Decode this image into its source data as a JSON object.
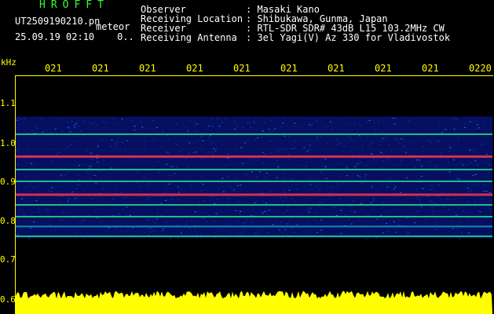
{
  "header": {
    "logo": "HROFFT",
    "filename": "UT2509190210.pn",
    "meteor_label": "meteor",
    "timestamp": "25.09.19 02:10",
    "count": "0.."
  },
  "info": [
    {
      "label": "Observer",
      "value": ": Masaki Kano"
    },
    {
      "label": "Receiving Location",
      "value": ": Shibukawa, Gunma, Japan"
    },
    {
      "label": "Receiver",
      "value": ": RTL-SDR SDR# 43dB L15 103.2MHz CW"
    },
    {
      "label": "Receiving Antenna",
      "value": ": 3el Yagi(V) Az 330 for Vladivostok"
    }
  ],
  "axes": {
    "y_unit": "kHz",
    "y_ticks": [
      "1.1",
      "1.0",
      "0.9",
      "0.8",
      "0.7",
      "0.6"
    ],
    "x_ticks": [
      "021",
      "021",
      "021",
      "021",
      "021",
      "021",
      "021",
      "021",
      "021",
      "0220"
    ]
  },
  "colors": {
    "background": "#000000",
    "axis": "#ffff00",
    "logo": "#33ff33",
    "text": "#ffffff",
    "noise": "#0a1a8c",
    "strong_line": "#ff3355",
    "level_bar": "#ffff00"
  },
  "spectrogram": {
    "y_range": [
      0.6,
      1.15
    ],
    "noise_band": [
      0.755,
      1.065
    ],
    "signal_lines": [
      {
        "freq": 1.02,
        "strength": "medium"
      },
      {
        "freq": 0.963,
        "strength": "strong"
      },
      {
        "freq": 0.93,
        "strength": "medium"
      },
      {
        "freq": 0.9,
        "strength": "medium"
      },
      {
        "freq": 0.866,
        "strength": "strong"
      },
      {
        "freq": 0.84,
        "strength": "medium"
      },
      {
        "freq": 0.81,
        "strength": "medium"
      },
      {
        "freq": 0.785,
        "strength": "weak"
      },
      {
        "freq": 0.76,
        "strength": "medium"
      }
    ]
  }
}
